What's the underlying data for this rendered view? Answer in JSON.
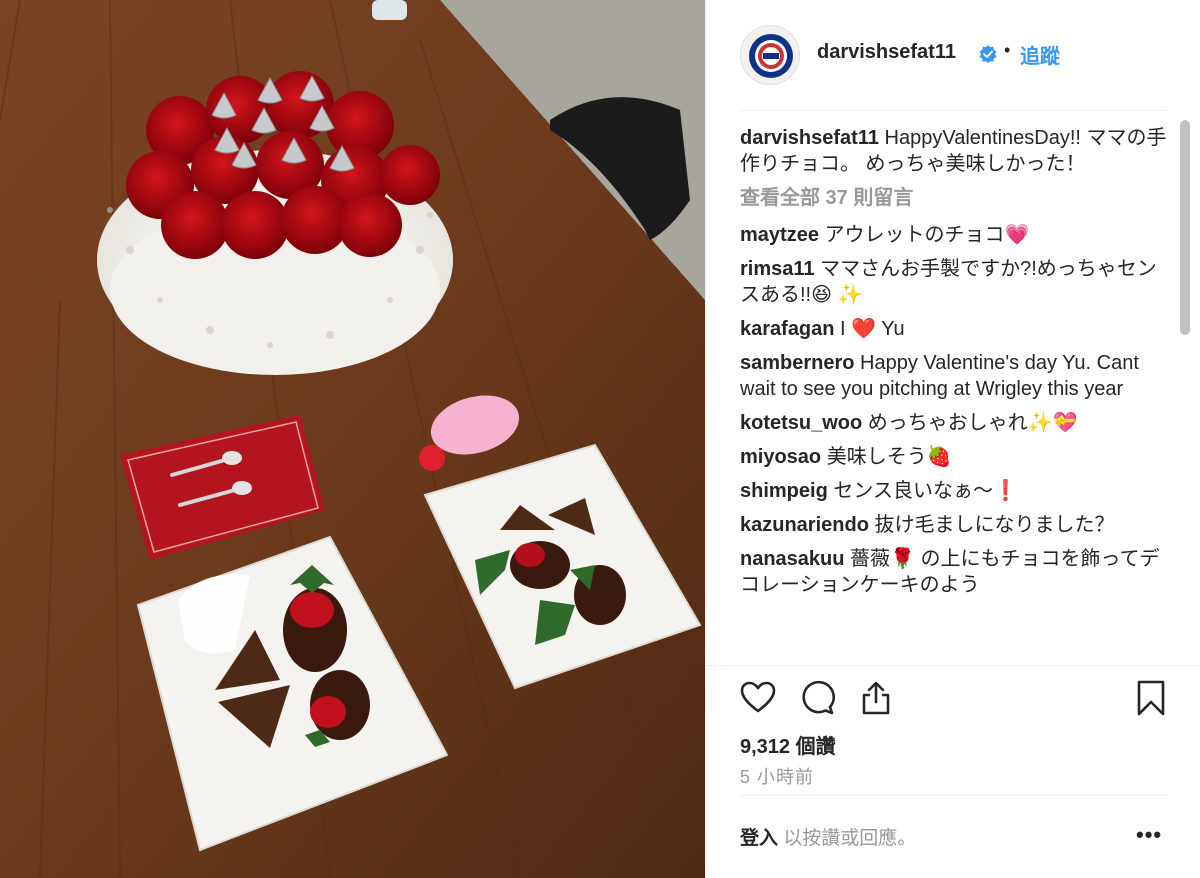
{
  "post": {
    "username": "darvishsefat11",
    "dot": "•",
    "follow_label": "追蹤",
    "view_all": "查看全部 37 則留言",
    "likes": "9,312 個讚",
    "time": "5 小時前",
    "login_link": "登入",
    "login_rest": " 以按讚或回應。",
    "more": "•••"
  },
  "comments": [
    {
      "user": "darvishsefat11",
      "text": " HappyValentinesDay!! ママの手作りチョコ。 めっちゃ美味しかった！"
    },
    {
      "user": "maytzee",
      "text": " アウレットのチョコ💗"
    },
    {
      "user": "rimsa11",
      "text": " ママさんお手製ですか?!めっちゃセンスある!!😆 ✨"
    },
    {
      "user": "karafagan",
      "text": " I ❤️  Yu"
    },
    {
      "user": "sambernero",
      "text": " Happy Valentine's day Yu. Cant wait to see you pitching at Wrigley this year"
    },
    {
      "user": "kotetsu_woo",
      "text": " めっちゃおしゃれ✨💝"
    },
    {
      "user": "miyosao",
      "text": " 美味しそう🍓"
    },
    {
      "user": "shimpeig",
      "text": " センス良いなぁ～❗️"
    },
    {
      "user": "kazunariendo",
      "text": " 抜け毛ましになりました？"
    },
    {
      "user": "nanasakuu",
      "text": " 薔薇🌹 の上にもチョコを飾ってデコレーションケーキのよう"
    }
  ],
  "colors": {
    "accent": "#3897f0",
    "text": "#262626",
    "muted": "#999999",
    "divider": "#efefef"
  },
  "icons": [
    "verified-badge-icon",
    "heart-icon",
    "comment-icon",
    "share-icon",
    "bookmark-icon"
  ]
}
